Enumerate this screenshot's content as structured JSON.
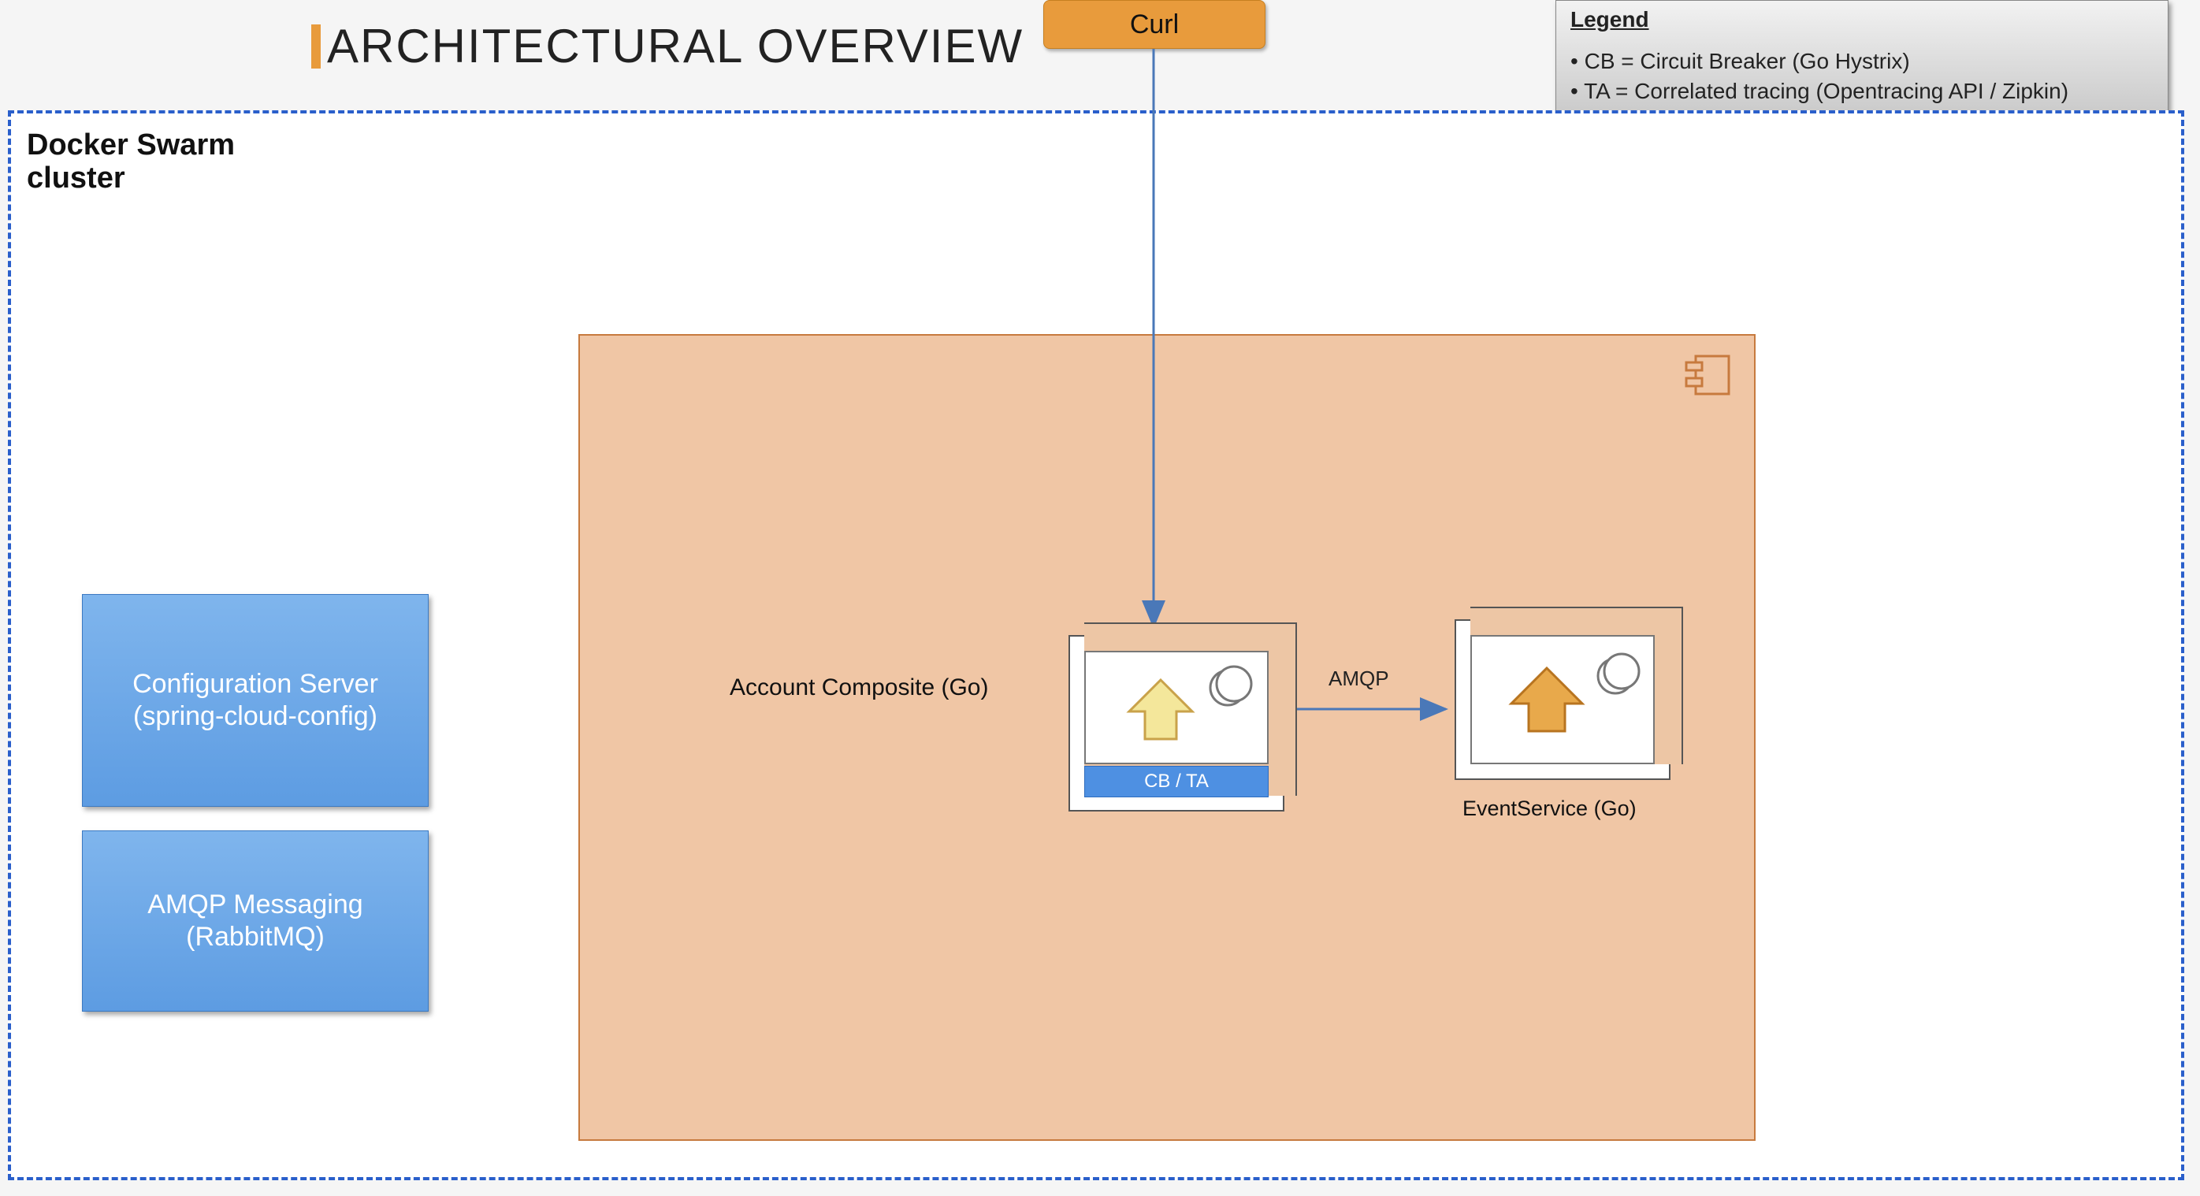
{
  "title": "ARCHITECTURAL OVERVIEW",
  "curl": {
    "label": "Curl"
  },
  "legend": {
    "title": "Legend",
    "items": [
      "CB = Circuit Breaker (Go Hystrix)",
      "TA = Correlated tracing (Opentracing API / Zipkin)"
    ]
  },
  "cluster": {
    "label_line1": "Docker Swarm",
    "label_line2": "cluster"
  },
  "sidebar": {
    "config_server": "Configuration Server\n(spring-cloud-config)",
    "amqp_messaging": "AMQP Messaging (RabbitMQ)"
  },
  "services": {
    "account_composite": {
      "label": "Account Composite (Go)",
      "badge": "CB / TA"
    },
    "event_service": {
      "label": "EventService (Go)"
    }
  },
  "connections": {
    "amqp_label": "AMQP"
  }
}
